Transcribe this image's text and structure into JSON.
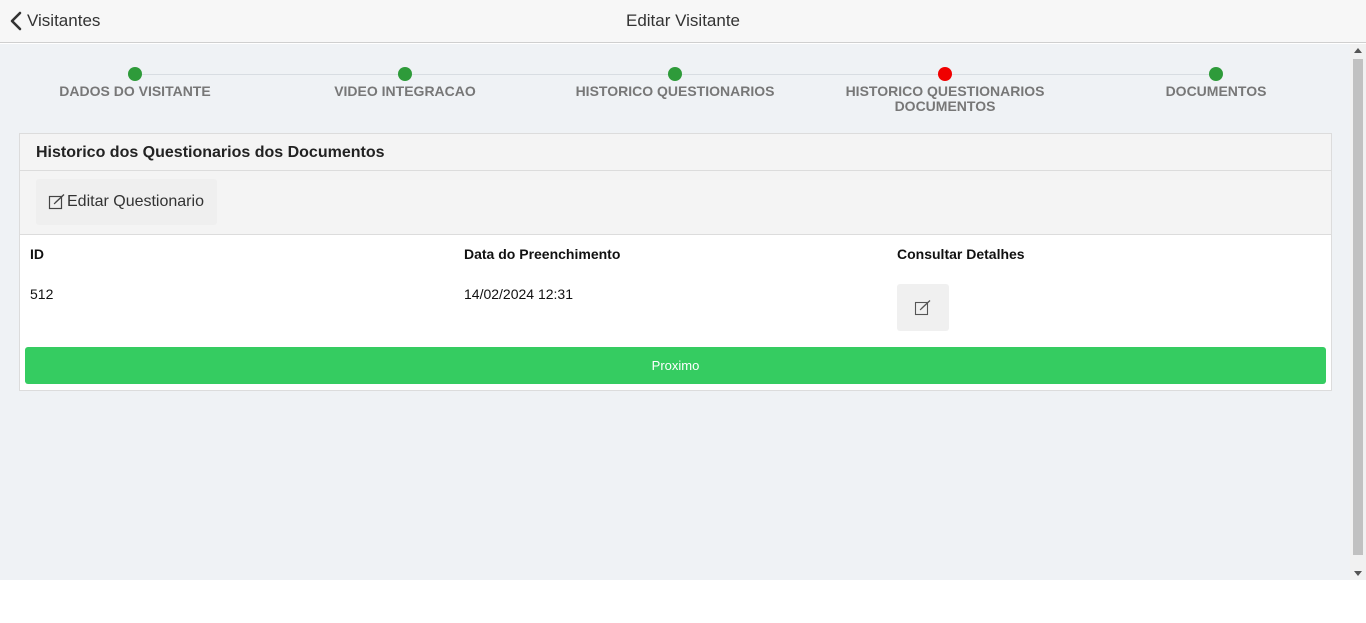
{
  "header": {
    "back_label": "Visitantes",
    "title": "Editar Visitante"
  },
  "stepper": {
    "steps": [
      {
        "label": "DADOS DO VISITANTE",
        "status": "complete"
      },
      {
        "label": "VIDEO INTEGRACAO",
        "status": "complete"
      },
      {
        "label": "HISTORICO QUESTIONARIOS",
        "status": "complete"
      },
      {
        "label": "HISTORICO QUESTIONARIOS DOCUMENTOS",
        "status": "current"
      },
      {
        "label": "DOCUMENTOS",
        "status": "complete"
      }
    ],
    "colors": {
      "complete": "#2e9b3a",
      "current": "#f00000"
    }
  },
  "panel": {
    "title": "Historico dos Questionarios dos Documentos",
    "edit_button_label": "Editar Questionario",
    "table": {
      "headers": [
        "ID",
        "Data do Preenchimento",
        "Consultar Detalhes"
      ],
      "rows": [
        {
          "id": "512",
          "date": "14/02/2024 12:31"
        }
      ]
    },
    "next_button_label": "Proximo"
  },
  "colors": {
    "accent_green": "#35cc61",
    "background": "#eff2f5"
  },
  "icons": {
    "back": "chevron-left-icon",
    "edit": "edit-square-icon"
  }
}
